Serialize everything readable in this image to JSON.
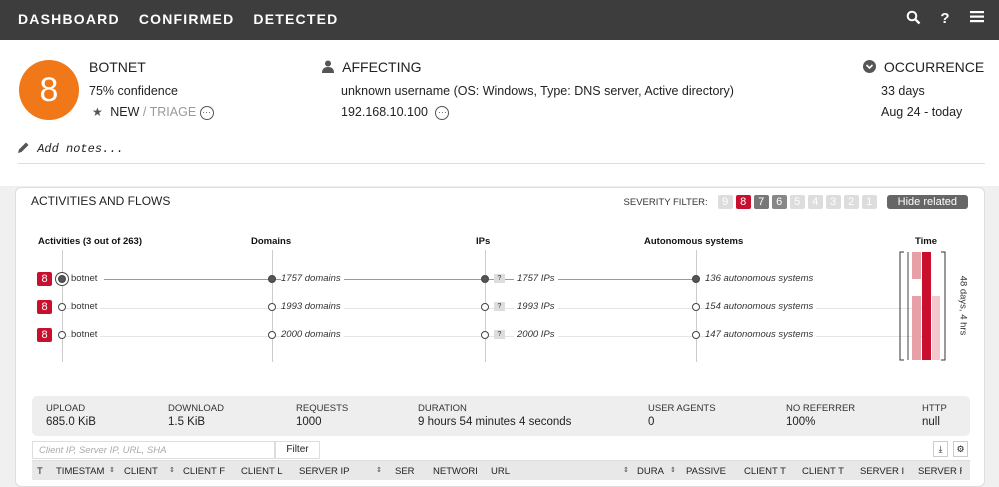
{
  "nav": {
    "items": [
      "DASHBOARD",
      "CONFIRMED",
      "DETECTED"
    ]
  },
  "icons": {
    "search": "search-icon",
    "help": "help-icon",
    "menu": "menu-icon"
  },
  "colors": {
    "score_orange": "#f07818",
    "severity_red": "#c8102e",
    "topbar": "#3d3d3d"
  },
  "header": {
    "score": "8",
    "threat_title": "BOTNET",
    "confidence": "75% confidence",
    "state": "NEW",
    "state_sep": "/",
    "triage": "TRIAGE",
    "affecting_title": "AFFECTING",
    "affecting_user": "unknown username (OS: Windows, Type: DNS server, Active directory)",
    "affecting_ip": "192.168.10.100",
    "occurrence_title": "OCCURRENCE",
    "occurrence_days": "33 days",
    "occurrence_range": "Aug 24 - today",
    "notes_placeholder": "Add notes..."
  },
  "panel": {
    "title": "ACTIVITIES AND FLOWS",
    "severity_label": "SEVERITY FILTER:",
    "severity_levels": [
      "9",
      "8",
      "7",
      "6",
      "5",
      "4",
      "3",
      "2",
      "1"
    ],
    "hide_related": "Hide related",
    "columns": {
      "activities": "Activities (3 out of 263)",
      "domains": "Domains",
      "ips": "IPs",
      "as": "Autonomous systems",
      "time": "Time"
    },
    "time_label": "48 days, 4 hrs",
    "flows": [
      {
        "badge": "8",
        "name": "botnet",
        "domains": "1757 domains",
        "ips": "1757 IPs",
        "as": "136 autonomous systems"
      },
      {
        "badge": "8",
        "name": "botnet",
        "domains": "1993 domains",
        "ips": "1993 IPs",
        "as": "154 autonomous systems"
      },
      {
        "badge": "8",
        "name": "botnet",
        "domains": "2000 domains",
        "ips": "2000 IPs",
        "as": "147 autonomous systems"
      }
    ],
    "ip_q": "?"
  },
  "stats": {
    "upload": {
      "k": "UPLOAD",
      "v": "685.0 KiB"
    },
    "download": {
      "k": "DOWNLOAD",
      "v": "1.5 KiB"
    },
    "requests": {
      "k": "REQUESTS",
      "v": "1000"
    },
    "duration": {
      "k": "DURATION",
      "v": "9 hours 54 minutes 4 seconds"
    },
    "user_agents": {
      "k": "USER AGENTS",
      "v": "0"
    },
    "no_referrer": {
      "k": "NO REFERRER",
      "v": "100%"
    },
    "http": {
      "k": "HTTP",
      "v": "null"
    }
  },
  "table": {
    "filter_placeholder": "Client IP, Server IP, URL, SHA",
    "filter_button": "Filter",
    "headers": [
      "T",
      "TIMESTAM",
      "CLIENT",
      "CLIENT F",
      "CLIENT L",
      "SERVER IP",
      "SER",
      "NETWORI",
      "URL",
      "DURA",
      "PASSIVE",
      "CLIENT T",
      "CLIENT T",
      "SERVER I",
      "SERVER F"
    ]
  }
}
